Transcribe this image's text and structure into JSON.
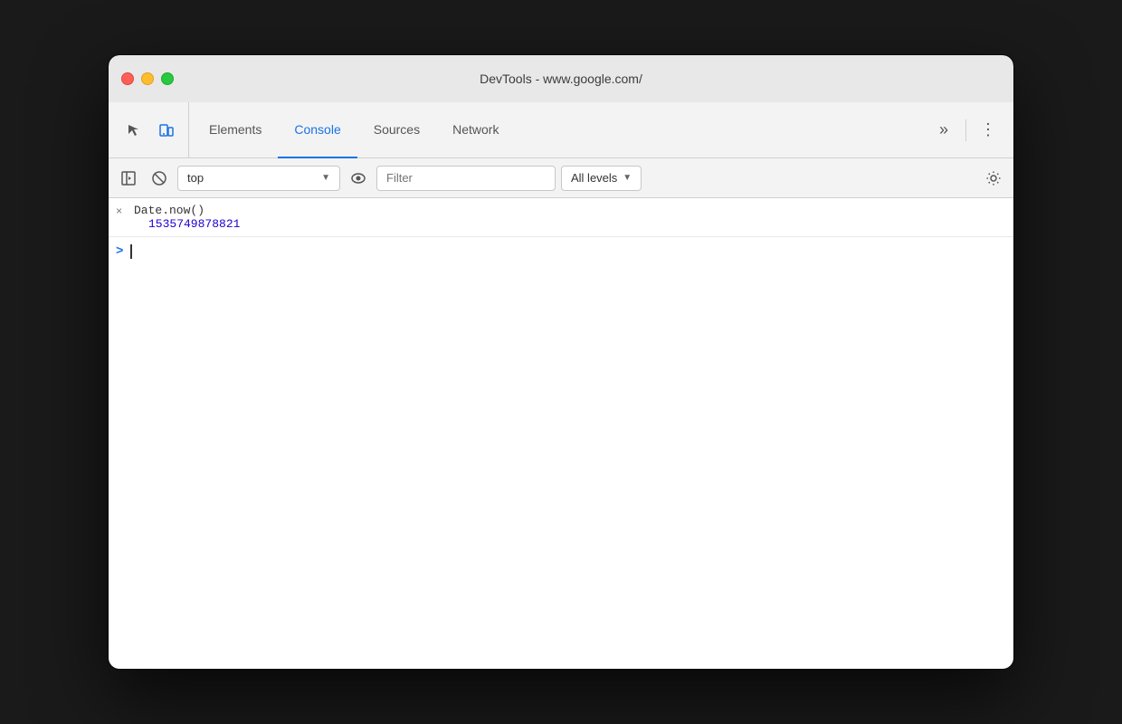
{
  "window": {
    "title": "DevTools - www.google.com/"
  },
  "tabs": {
    "items": [
      {
        "id": "elements",
        "label": "Elements",
        "active": false
      },
      {
        "id": "console",
        "label": "Console",
        "active": true
      },
      {
        "id": "sources",
        "label": "Sources",
        "active": false
      },
      {
        "id": "network",
        "label": "Network",
        "active": false
      }
    ],
    "more_label": "»",
    "more_options_label": "⋮"
  },
  "toolbar": {
    "context_value": "top",
    "context_arrow": "▼",
    "filter_placeholder": "Filter",
    "levels_label": "All levels",
    "levels_arrow": "▼"
  },
  "console": {
    "entry_icon": "×",
    "entry_command": "Date.now()",
    "entry_result": "1535749878821",
    "prompt": ">"
  },
  "colors": {
    "active_tab": "#1a73e8",
    "result_color": "#1c00cf",
    "prompt_color": "#1a73e8"
  }
}
